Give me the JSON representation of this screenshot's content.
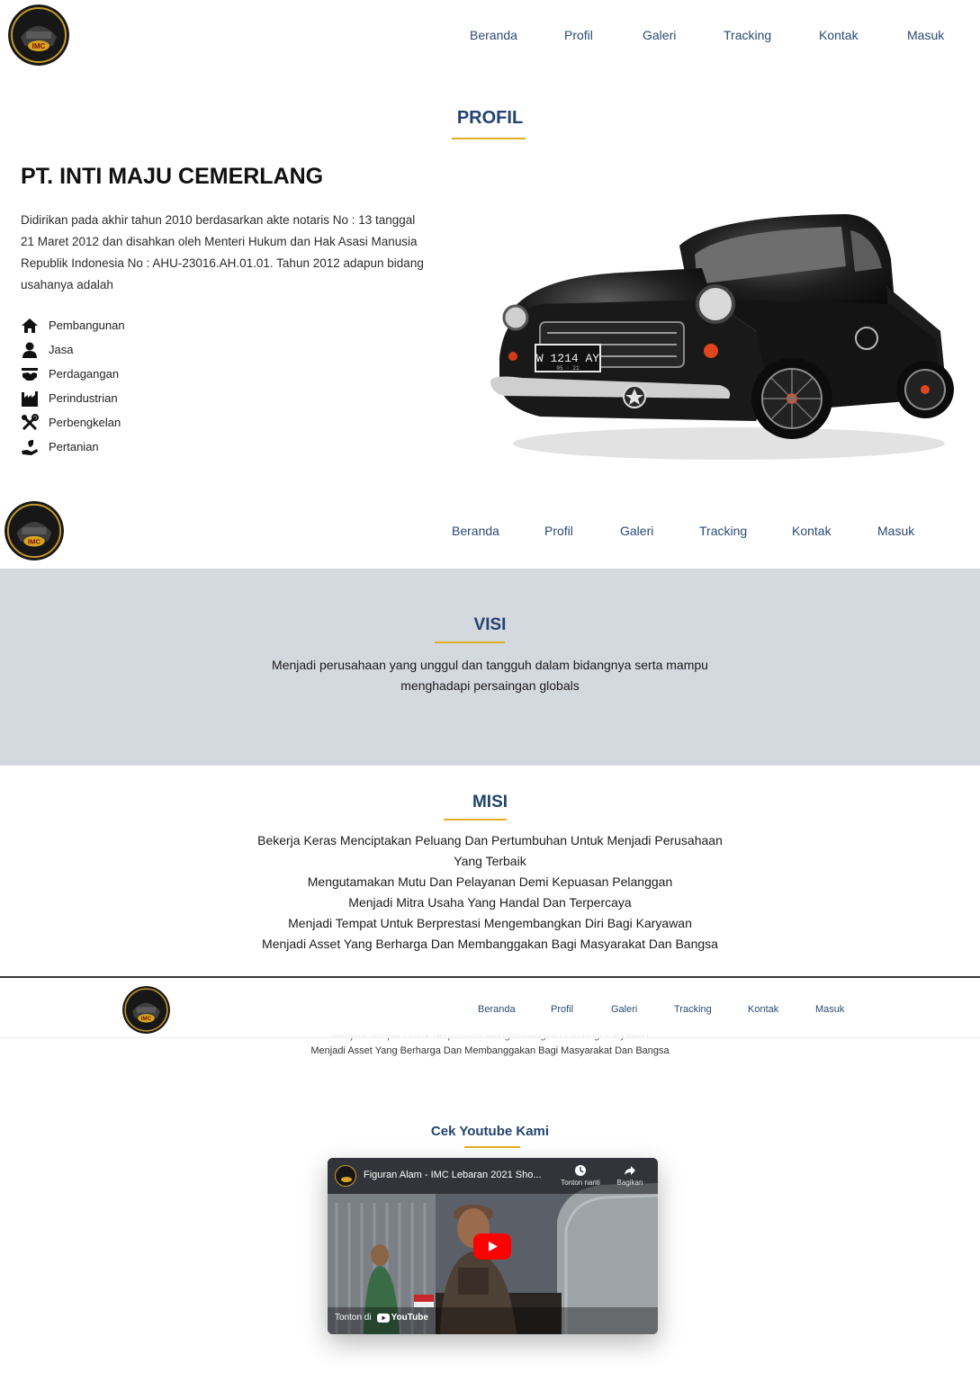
{
  "nav": {
    "logo_text": "IMC",
    "items": [
      "Beranda",
      "Profil",
      "Galeri",
      "Tracking",
      "Kontak",
      "Masuk"
    ]
  },
  "profil": {
    "section_title": "PROFIL",
    "company_name": "PT. INTI MAJU CEMERLANG",
    "description_lines": [
      "Didirikan pada akhir tahun 2010 berdasarkan akte notaris No : 13 tanggal",
      "21 Maret 2012 dan disahkan oleh Menteri Hukum dan Hak Asasi Manusia",
      "Republik Indonesia No : AHU-23016.AH.01.01. Tahun 2012 adapun bidang",
      "usahanya adalah"
    ],
    "services": [
      {
        "label": "Pembangunan",
        "icon": "home-icon"
      },
      {
        "label": "Jasa",
        "icon": "user-icon"
      },
      {
        "label": "Perdagangan",
        "icon": "handshake-icon"
      },
      {
        "label": "Perindustrian",
        "icon": "industry-icon"
      },
      {
        "label": "Perbengkelan",
        "icon": "tools-icon"
      },
      {
        "label": "Pertanian",
        "icon": "seedling-icon"
      }
    ],
    "car_plate": "W 1214 AY",
    "car_plate_sub": "05 · 21"
  },
  "visi": {
    "title": "VISI",
    "lines": [
      "Menjadi perusahaan yang unggul dan tangguh dalam bidangnya serta mampu",
      "menghadapi persaingan globals"
    ]
  },
  "misi": {
    "title": "MISI",
    "lines": [
      "Bekerja Keras Menciptakan Peluang Dan Pertumbuhan Untuk Menjadi Perusahaan",
      "Yang Terbaik",
      "Mengutamakan Mutu Dan Pelayanan Demi Kepuasan Pelanggan",
      "Menjadi Mitra Usaha Yang Handal Dan Terpercaya",
      "Menjadi Tempat Untuk Berprestasi Mengembangkan Diri Bagi Karyawan",
      "Menjadi Asset Yang Berharga Dan Membanggakan Bagi Masyarakat Dan Bangsa"
    ]
  },
  "youtube": {
    "title": "Cek Youtube Kami",
    "video_title": "Figuran Alam - IMC Lebaran 2021 Sho...",
    "watch_later": "Tonton nanti",
    "share": "Bagikan",
    "watch_on": "Tonton di",
    "brand": "YouTube"
  },
  "colors": {
    "nav_text": "#2a4a73",
    "title": "#23436e",
    "accent": "#e3b023",
    "band": "#d4d8df"
  }
}
